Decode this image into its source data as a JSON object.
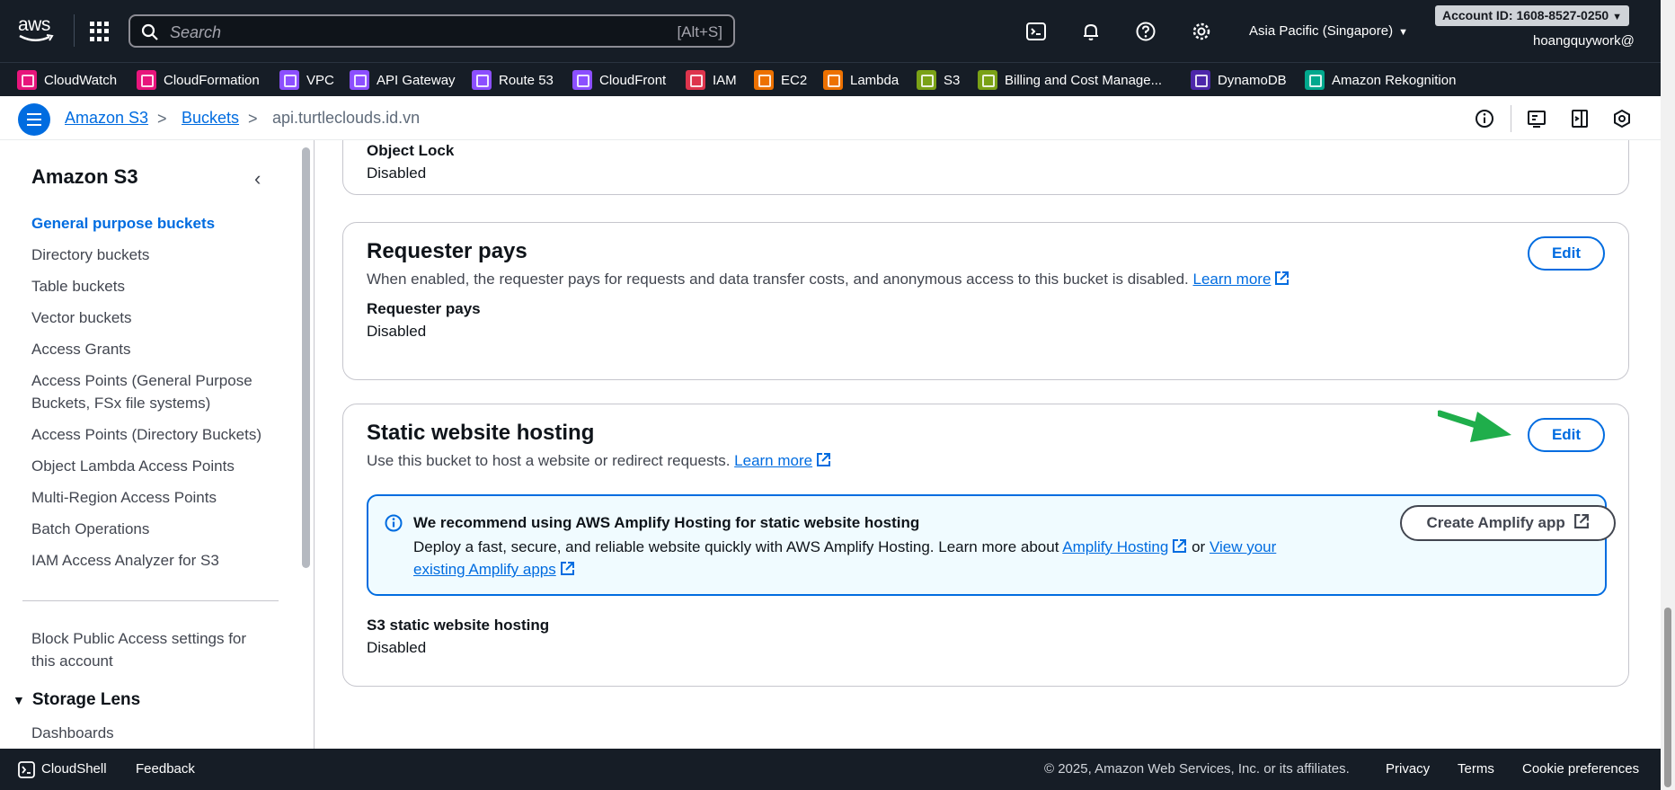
{
  "topnav": {
    "logo": "aws",
    "search_placeholder": "Search",
    "search_shortcut": "[Alt+S]",
    "region": "Asia Pacific (Singapore)",
    "account": "Account ID: 1608-8527-0250",
    "user": "hoangquywork@"
  },
  "favorites": [
    {
      "label": "CloudWatch",
      "color": "#e7157b"
    },
    {
      "label": "CloudFormation",
      "color": "#e7157b"
    },
    {
      "label": "VPC",
      "color": "#8c4fff"
    },
    {
      "label": "API Gateway",
      "color": "#8c4fff"
    },
    {
      "label": "Route 53",
      "color": "#8c4fff"
    },
    {
      "label": "CloudFront",
      "color": "#8c4fff"
    },
    {
      "label": "IAM",
      "color": "#dd344c"
    },
    {
      "label": "EC2",
      "color": "#ed7100"
    },
    {
      "label": "Lambda",
      "color": "#ed7100"
    },
    {
      "label": "S3",
      "color": "#7aa116"
    },
    {
      "label": "Billing and Cost Manage...",
      "color": "#7aa116"
    },
    {
      "label": "DynamoDB",
      "color": "#4d27aa"
    },
    {
      "label": "Amazon Rekognition",
      "color": "#01a88d"
    }
  ],
  "breadcrumb": {
    "items": [
      "Amazon S3",
      "Buckets",
      "api.turtleclouds.id.vn"
    ]
  },
  "sidebar": {
    "title": "Amazon S3",
    "items": [
      "General purpose buckets",
      "Directory buckets",
      "Table buckets",
      "Vector buckets",
      "Access Grants",
      "Access Points (General Purpose Buckets, FSx file systems)",
      "Access Points (Directory Buckets)",
      "Object Lambda Access Points",
      "Multi-Region Access Points",
      "Batch Operations",
      "IAM Access Analyzer for S3"
    ],
    "block_public": "Block Public Access settings for this account",
    "section": "Storage Lens",
    "section_items": [
      "Dashboards"
    ]
  },
  "object_lock": {
    "key": "Object Lock",
    "value": "Disabled"
  },
  "requester_pays": {
    "title": "Requester pays",
    "desc": "When enabled, the requester pays for requests and data transfer costs, and anonymous access to this bucket is disabled.",
    "learn_more": "Learn more",
    "edit": "Edit",
    "key": "Requester pays",
    "value": "Disabled"
  },
  "static_hosting": {
    "title": "Static website hosting",
    "desc": "Use this bucket to host a website or redirect requests.",
    "learn_more": "Learn more",
    "edit": "Edit",
    "alert_title": "We recommend using AWS Amplify Hosting for static website hosting",
    "alert_body": "Deploy a fast, secure, and reliable website quickly with AWS Amplify Hosting. Learn more about",
    "alert_link1": "Amplify Hosting",
    "alert_or": "or",
    "alert_link2": "View your existing Amplify apps",
    "create_amplify": "Create Amplify app",
    "key": "S3 static website hosting",
    "value": "Disabled"
  },
  "footer": {
    "cloudshell": "CloudShell",
    "feedback": "Feedback",
    "copyright": "© 2025, Amazon Web Services, Inc. or its affiliates.",
    "privacy": "Privacy",
    "terms": "Terms",
    "cookies": "Cookie preferences"
  },
  "colors": {
    "nav_bg": "#161d26",
    "link": "#006ce0",
    "arrow": "#1fae4b"
  }
}
